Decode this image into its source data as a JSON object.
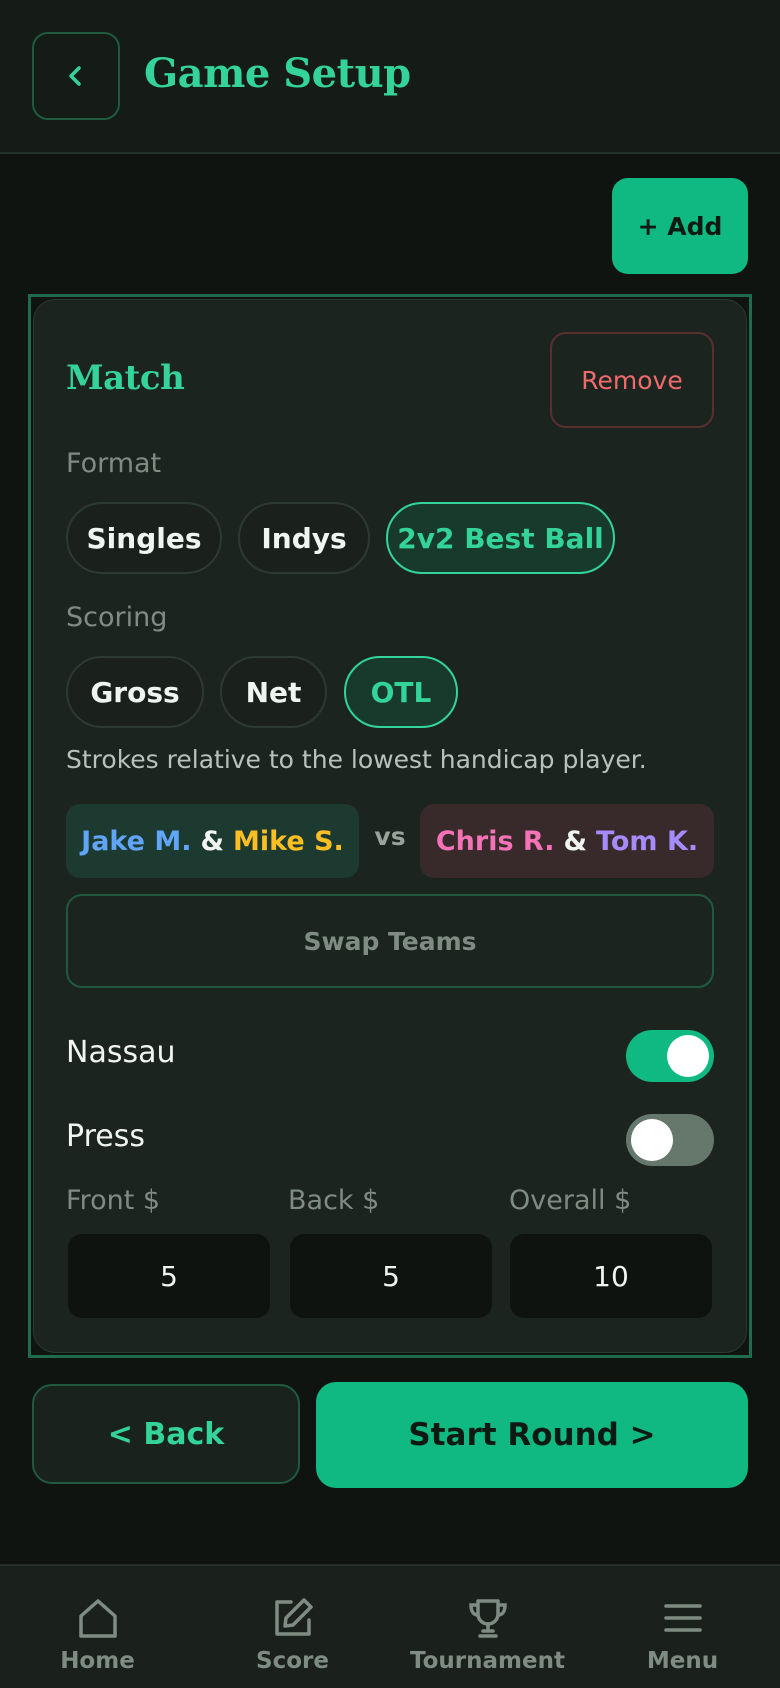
{
  "header": {
    "title": "Game Setup"
  },
  "toolbar": {
    "add_label": "+ Add"
  },
  "card": {
    "title": "Match",
    "remove_label": "Remove",
    "format_label": "Format",
    "format_options": [
      "Singles",
      "Indys",
      "2v2 Best Ball"
    ],
    "format_selected": "2v2 Best Ball",
    "scoring_label": "Scoring",
    "scoring_options": [
      "Gross",
      "Net",
      "OTL"
    ],
    "scoring_selected": "OTL",
    "helper_text": "Strokes relative to the lowest handicap player.",
    "team_a": {
      "p1": "Jake M.",
      "p2": "Mike S.",
      "p1_color": "#60a5fa",
      "p2_color": "#fbbf24"
    },
    "team_b": {
      "p1": "Chris R.",
      "p2": "Tom K.",
      "p1_color": "#f472b6",
      "p2_color": "#a78bfa"
    },
    "amp": "&",
    "vs": "vs",
    "swap_label": "Swap Teams",
    "nassau": {
      "label": "Nassau",
      "on": true
    },
    "press": {
      "label": "Press",
      "on": false
    },
    "bets": {
      "front_label": "Front $",
      "front_value": "5",
      "back_label": "Back $",
      "back_value": "5",
      "overall_label": "Overall $",
      "overall_value": "10"
    }
  },
  "footer": {
    "back_label": "< Back",
    "start_label": "Start Round >"
  },
  "tabs": [
    {
      "label": "Home",
      "icon": "home-icon"
    },
    {
      "label": "Score",
      "icon": "edit-icon"
    },
    {
      "label": "Tournament",
      "icon": "trophy-icon"
    },
    {
      "label": "Menu",
      "icon": "menu-icon"
    }
  ],
  "colors": {
    "accent": "#10b981",
    "accent_text": "#34d399",
    "danger": "#ef6b6b"
  }
}
